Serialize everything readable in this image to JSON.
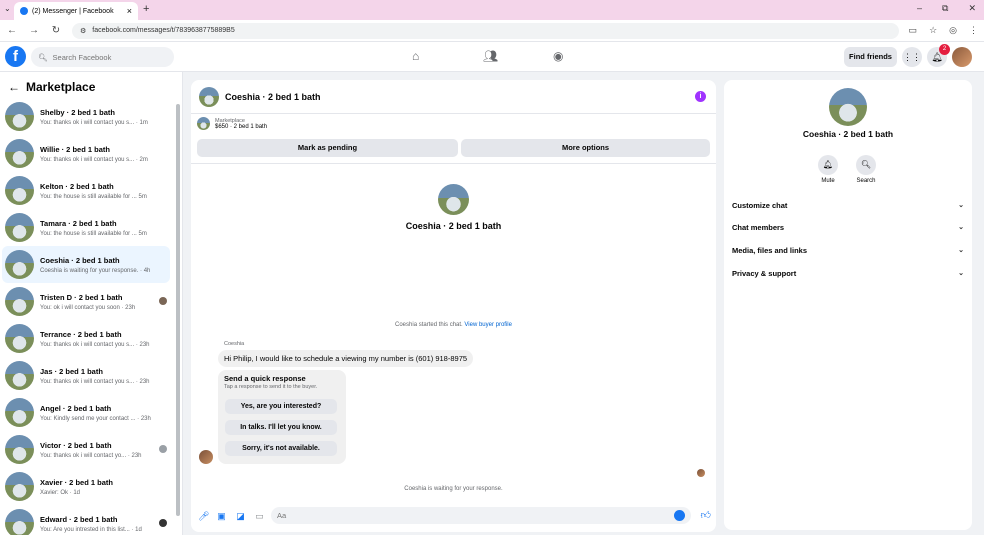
{
  "browser": {
    "tab_title": "(2) Messenger | Facebook",
    "tab_close": "×",
    "new_tab": "+",
    "url": "facebook.com/messages/t/7839638775889B5",
    "window_controls": [
      "–",
      "⧉",
      "✕"
    ]
  },
  "header": {
    "logo": "f",
    "search_placeholder": "Search Facebook",
    "find_friends_label": "Find friends",
    "notification_count": "2"
  },
  "sidebar": {
    "title": "Marketplace",
    "back_glyph": "←",
    "conversations": [
      {
        "name": "Shelby · 2 bed 1 bath",
        "snippet": "You: thanks ok i will contact you s... · 1m"
      },
      {
        "name": "Willie · 2 bed 1 bath",
        "snippet": "You: thanks ok i will contact you s... · 2m"
      },
      {
        "name": "Kelton · 2 bed 1 bath",
        "snippet": "You: the house is still available for ... 5m"
      },
      {
        "name": "Tamara · 2 bed 1 bath",
        "snippet": "You: the house is still available for ... 5m"
      },
      {
        "name": "Coeshia · 2 bed 1 bath",
        "snippet": "Coeshia is waiting for your response. · 4h"
      },
      {
        "name": "Tristen D · 2 bed 1 bath",
        "snippet": "You: ok i will contact you soon · 23h"
      },
      {
        "name": "Terrance · 2 bed 1 bath",
        "snippet": "You: thanks ok i will contact you s... · 23h"
      },
      {
        "name": "Jas · 2 bed 1 bath",
        "snippet": "You: thanks ok i will contact you s... · 23h"
      },
      {
        "name": "Angel · 2 bed 1 bath",
        "snippet": "You: Kindly send me your contact ... · 23h"
      },
      {
        "name": "Victor · 2 bed 1 bath",
        "snippet": "You: thanks ok i will contact yo... · 23h"
      },
      {
        "name": "Xavier · 2 bed 1 bath",
        "snippet": "Xavier: Ok · 1d"
      },
      {
        "name": "Edward · 2 bed 1 bath",
        "snippet": "You: Are you intrested in this list... · 1d"
      }
    ]
  },
  "chat": {
    "title": "Coeshia · 2 bed 1 bath",
    "info_glyph": "i",
    "listing_label": "Marketplace",
    "listing_detail": "$650 · 2 bed 1 bath",
    "mark_pending_label": "Mark as pending",
    "more_options_label": "More options",
    "profile_name": "Coeshia · 2 bed 1 bath",
    "started_text": "Coeshia started this chat.",
    "view_profile_link": "View buyer profile",
    "sender_name": "Coeshia",
    "message": "Hi Philip, I would like to schedule a viewing my number is (601) 918-8975",
    "quick_title": "Send a quick response",
    "quick_subtitle": "Tap a response to send it to the buyer.",
    "quick_options": [
      "Yes, are you interested?",
      "In talks. I'll let you know.",
      "Sorry, it's not available."
    ],
    "waiting_text": "Coeshia is waiting for your response.",
    "input_placeholder": "Aa"
  },
  "info_panel": {
    "name": "Coeshia · 2 bed 1 bath",
    "mute_label": "Mute",
    "search_label": "Search",
    "sections": [
      "Customize chat",
      "Chat members",
      "Media, files and links",
      "Privacy & support"
    ]
  }
}
